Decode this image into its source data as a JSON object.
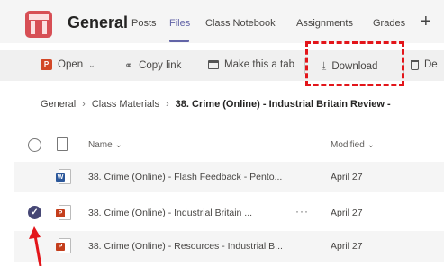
{
  "header": {
    "channel_title": "General",
    "tabs": [
      {
        "label": "Posts",
        "active": false
      },
      {
        "label": "Files",
        "active": true
      },
      {
        "label": "Class Notebook",
        "active": false
      },
      {
        "label": "Assignments",
        "active": false
      },
      {
        "label": "Grades",
        "active": false
      }
    ],
    "add_tab_symbol": "+"
  },
  "toolbar": {
    "open_label": "Open",
    "copy_link_label": "Copy link",
    "make_tab_label": "Make this a tab",
    "download_label": "Download",
    "delete_label": "De"
  },
  "breadcrumb": {
    "items": [
      "General",
      "Class Materials",
      "38. Crime (Online) - Industrial Britain Review -"
    ]
  },
  "file_list": {
    "columns": {
      "name": "Name",
      "modified": "Modified"
    },
    "rows": [
      {
        "name": "38. Crime (Online) - Flash Feedback - Pento...",
        "modified": "April 27",
        "type": "word",
        "selected": false
      },
      {
        "name": "38. Crime (Online) - Industrial Britain ...",
        "modified": "April 27",
        "type": "ppt",
        "selected": true
      },
      {
        "name": "38. Crime (Online) - Resources - Industrial B...",
        "modified": "April 27",
        "type": "ppt",
        "selected": false
      }
    ],
    "more_options": "···"
  },
  "colors": {
    "accent": "#6264a7",
    "highlight": "#e3151a",
    "check": "#464775"
  }
}
